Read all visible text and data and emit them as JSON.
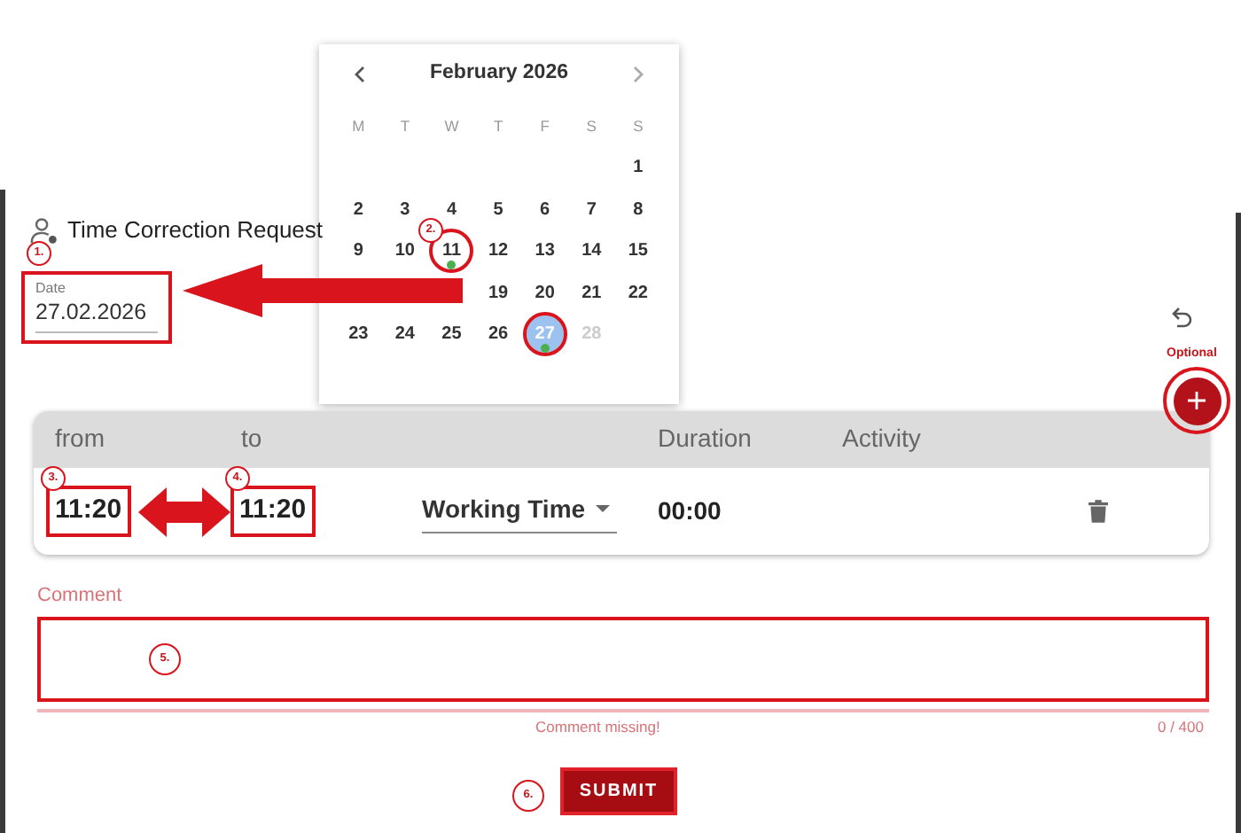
{
  "form": {
    "title": "Time Correction Request",
    "date": {
      "label": "Date",
      "value": "27.02.2026",
      "highlighted": true
    }
  },
  "calendar": {
    "month": "February 2026",
    "weekdays": [
      "M",
      "T",
      "W",
      "T",
      "F",
      "S",
      "S"
    ],
    "weeks": [
      [
        {
          "kind": "blank"
        },
        {
          "kind": "blank"
        },
        {
          "kind": "blank"
        },
        {
          "kind": "blank"
        },
        {
          "kind": "blank"
        },
        {
          "kind": "blank"
        },
        {
          "kind": "day",
          "label": "1",
          "selected": false,
          "event": false,
          "disabled": false,
          "circled": false
        }
      ],
      [
        {
          "kind": "day",
          "label": "2",
          "selected": false,
          "event": false,
          "disabled": false,
          "circled": false
        },
        {
          "kind": "day",
          "label": "3",
          "selected": false,
          "event": false,
          "disabled": false,
          "circled": false
        },
        {
          "kind": "day",
          "label": "4",
          "selected": false,
          "event": false,
          "disabled": false,
          "circled": false
        },
        {
          "kind": "day",
          "label": "5",
          "selected": false,
          "event": false,
          "disabled": false,
          "circled": false
        },
        {
          "kind": "day",
          "label": "6",
          "selected": false,
          "event": false,
          "disabled": false,
          "circled": false
        },
        {
          "kind": "day",
          "label": "7",
          "selected": false,
          "event": false,
          "disabled": false,
          "circled": false
        },
        {
          "kind": "day",
          "label": "8",
          "selected": false,
          "event": false,
          "disabled": false,
          "circled": false
        }
      ],
      [
        {
          "kind": "day",
          "label": "9",
          "selected": false,
          "event": false,
          "disabled": false,
          "circled": false
        },
        {
          "kind": "day",
          "label": "10",
          "selected": false,
          "event": false,
          "disabled": false,
          "circled": false
        },
        {
          "kind": "day",
          "label": "11",
          "selected": false,
          "event": true,
          "disabled": false,
          "circled": true
        },
        {
          "kind": "day",
          "label": "12",
          "selected": false,
          "event": false,
          "disabled": false,
          "circled": false
        },
        {
          "kind": "day",
          "label": "13",
          "selected": false,
          "event": false,
          "disabled": false,
          "circled": false
        },
        {
          "kind": "day",
          "label": "14",
          "selected": false,
          "event": false,
          "disabled": false,
          "circled": false
        },
        {
          "kind": "day",
          "label": "15",
          "selected": false,
          "event": false,
          "disabled": false,
          "circled": false
        }
      ],
      [
        {
          "kind": "blank"
        },
        {
          "kind": "blank"
        },
        {
          "kind": "blank"
        },
        {
          "kind": "day",
          "label": "19",
          "selected": false,
          "event": false,
          "disabled": false,
          "circled": false
        },
        {
          "kind": "day",
          "label": "20",
          "selected": false,
          "event": false,
          "disabled": false,
          "circled": false
        },
        {
          "kind": "day",
          "label": "21",
          "selected": false,
          "event": false,
          "disabled": false,
          "circled": false
        },
        {
          "kind": "day",
          "label": "22",
          "selected": false,
          "event": false,
          "disabled": false,
          "circled": false
        }
      ],
      [
        {
          "kind": "day",
          "label": "23",
          "selected": false,
          "event": false,
          "disabled": false,
          "circled": false
        },
        {
          "kind": "day",
          "label": "24",
          "selected": false,
          "event": false,
          "disabled": false,
          "circled": false
        },
        {
          "kind": "day",
          "label": "25",
          "selected": false,
          "event": false,
          "disabled": false,
          "circled": false
        },
        {
          "kind": "day",
          "label": "26",
          "selected": false,
          "event": false,
          "disabled": false,
          "circled": false
        },
        {
          "kind": "day",
          "label": "27",
          "selected": true,
          "event": true,
          "disabled": false,
          "circled": true
        },
        {
          "kind": "day",
          "label": "28",
          "selected": false,
          "event": false,
          "disabled": true,
          "circled": false
        },
        {
          "kind": "blank"
        }
      ]
    ]
  },
  "table": {
    "columns": [
      "from",
      "to",
      "Duration",
      "Activity"
    ],
    "rows": [
      {
        "from": "11:20",
        "to": "11:20",
        "activity": "Working Time",
        "duration": "00:00",
        "from_highlighted": true,
        "to_highlighted": true
      }
    ]
  },
  "comment": {
    "label": "Comment",
    "error": "Comment missing!",
    "counter": "0 / 400",
    "highlighted": true
  },
  "submit": {
    "label": "SUBMIT",
    "highlighted": true
  },
  "add_button": {
    "note": "Optional",
    "circled": true
  },
  "annotations": [
    {
      "label": "1."
    },
    {
      "label": "2."
    },
    {
      "label": "3."
    },
    {
      "label": "4."
    },
    {
      "label": "5."
    },
    {
      "label": "6."
    }
  ]
}
